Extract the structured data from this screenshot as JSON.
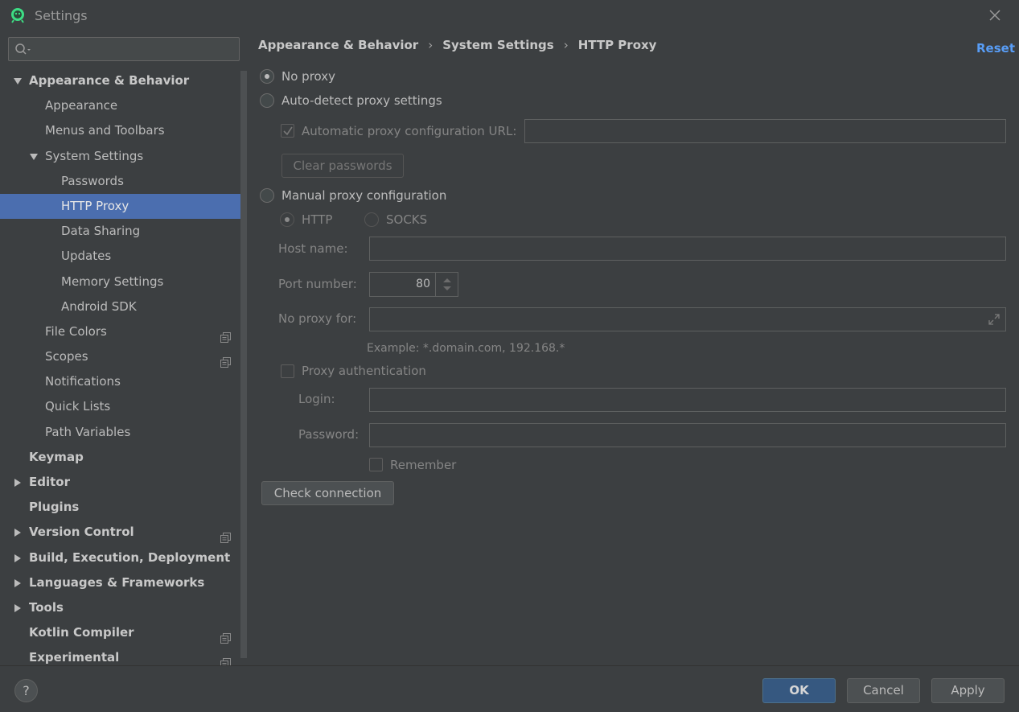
{
  "window": {
    "title": "Settings",
    "colors": {
      "background": "#3c3f41",
      "selection": "#4b6eaf",
      "link": "#589df6",
      "primary_button": "#365880"
    }
  },
  "search": {
    "value": "",
    "placeholder": ""
  },
  "sidebar": {
    "items": [
      {
        "label": "Appearance & Behavior",
        "level": 0,
        "bold": true,
        "arrow": "down"
      },
      {
        "label": "Appearance",
        "level": 1
      },
      {
        "label": "Menus and Toolbars",
        "level": 1
      },
      {
        "label": "System Settings",
        "level": 1,
        "arrow": "down"
      },
      {
        "label": "Passwords",
        "level": 2
      },
      {
        "label": "HTTP Proxy",
        "level": 2,
        "selected": true
      },
      {
        "label": "Data Sharing",
        "level": 2
      },
      {
        "label": "Updates",
        "level": 2
      },
      {
        "label": "Memory Settings",
        "level": 2
      },
      {
        "label": "Android SDK",
        "level": 2
      },
      {
        "label": "File Colors",
        "level": 1,
        "copy_icon": true
      },
      {
        "label": "Scopes",
        "level": 1,
        "copy_icon": true
      },
      {
        "label": "Notifications",
        "level": 1
      },
      {
        "label": "Quick Lists",
        "level": 1
      },
      {
        "label": "Path Variables",
        "level": 1
      },
      {
        "label": "Keymap",
        "level": 0,
        "bold": true
      },
      {
        "label": "Editor",
        "level": 0,
        "bold": true,
        "arrow": "right"
      },
      {
        "label": "Plugins",
        "level": 0,
        "bold": true
      },
      {
        "label": "Version Control",
        "level": 0,
        "bold": true,
        "arrow": "right",
        "copy_icon": true
      },
      {
        "label": "Build, Execution, Deployment",
        "level": 0,
        "bold": true,
        "arrow": "right"
      },
      {
        "label": "Languages & Frameworks",
        "level": 0,
        "bold": true,
        "arrow": "right"
      },
      {
        "label": "Tools",
        "level": 0,
        "bold": true,
        "arrow": "right"
      },
      {
        "label": "Kotlin Compiler",
        "level": 0,
        "bold": true,
        "copy_icon": true
      },
      {
        "label": "Experimental",
        "level": 0,
        "bold": true,
        "copy_icon": true
      }
    ]
  },
  "breadcrumb": {
    "items": [
      "Appearance & Behavior",
      "System Settings",
      "HTTP Proxy"
    ],
    "separator": "›"
  },
  "reset_label": "Reset",
  "proxy": {
    "no_proxy_label": "No proxy",
    "auto_detect_label": "Auto-detect proxy settings",
    "auto_config_url_label": "Automatic proxy configuration URL:",
    "auto_config_url_value": "",
    "clear_passwords_label": "Clear passwords",
    "manual_label": "Manual proxy configuration",
    "http_label": "HTTP",
    "socks_label": "SOCKS",
    "host_name_label": "Host name:",
    "host_name_value": "",
    "port_number_label": "Port number:",
    "port_number_value": "80",
    "no_proxy_for_label": "No proxy for:",
    "no_proxy_for_value": "",
    "example_text": "Example: *.domain.com, 192.168.*",
    "proxy_auth_label": "Proxy authentication",
    "login_label": "Login:",
    "login_value": "",
    "password_label": "Password:",
    "password_value": "",
    "remember_label": "Remember",
    "check_connection_label": "Check connection"
  },
  "footer": {
    "help_label": "?",
    "ok_label": "OK",
    "cancel_label": "Cancel",
    "apply_label": "Apply"
  }
}
